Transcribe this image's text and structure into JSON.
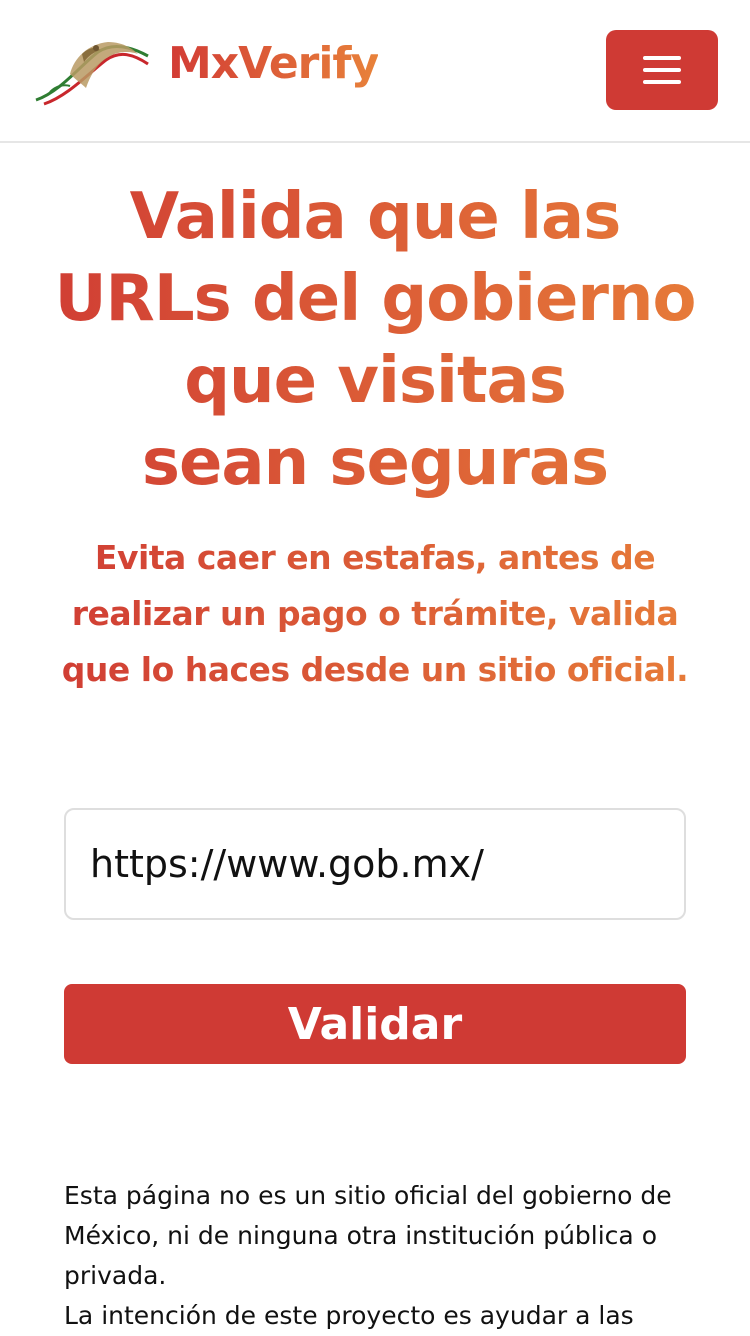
{
  "navbar": {
    "brand": "MxVerify",
    "logo_icon": "mexican-eagle-logo",
    "menu_icon": "hamburger-menu-icon",
    "colors": {
      "accent": "#cf3a34",
      "gradient_end": "#e87f39"
    }
  },
  "hero": {
    "title_lines": [
      "Valida que las",
      "URLs del gobierno",
      "que visitas",
      "sean seguras"
    ],
    "subtitle_lines": [
      "Evita caer en estafas, antes de",
      "realizar un pago o trámite, valida",
      "que lo haces desde un sitio oficial."
    ]
  },
  "form": {
    "url_value": "https://www.gob.mx/",
    "button_label": "Validar"
  },
  "disclaimer": {
    "paragraph_1": "Esta página no es un sitio oficial del gobierno de México, ni de ninguna otra institución pública o privada.",
    "paragraph_2": "La intención de este proyecto es ayudar a las"
  }
}
